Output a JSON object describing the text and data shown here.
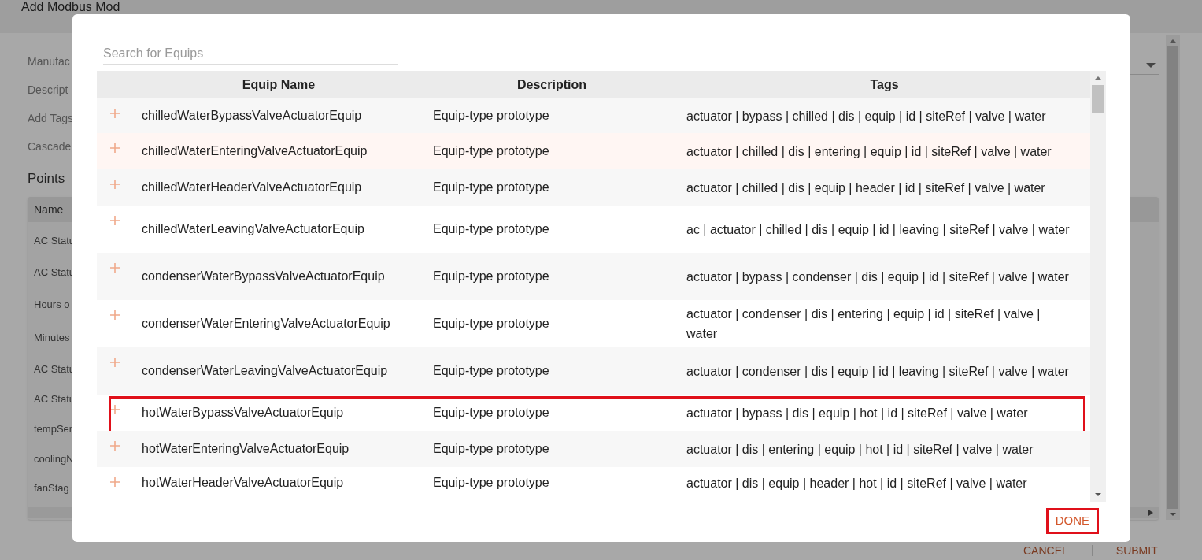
{
  "page": {
    "title": "Add Modbus Mod",
    "fields": [
      "Manufac",
      "Descript",
      "Add Tags",
      "Cascade"
    ],
    "section_title": "Points",
    "points_table": {
      "column": "Name",
      "rows": [
        "AC Statu",
        "AC Statu",
        "Hours o",
        "Minutes",
        "AC Statu",
        "AC Statu",
        "tempSer",
        "coolingN",
        "fanStag"
      ]
    },
    "buttons": [
      "CANCEL",
      "SUBMIT"
    ]
  },
  "dialog": {
    "search": {
      "placeholder": "Search for Equips"
    },
    "columns": [
      "Equip Name",
      "Description",
      "Tags"
    ],
    "rows": [
      {
        "name": "chilledWaterBypassValveActuatorEquip",
        "description": "Equip-type prototype",
        "tags": "actuator | bypass | chilled | dis | equip | id | siteRef | valve | water",
        "hovered": false,
        "highlighted": false
      },
      {
        "name": "chilledWaterEnteringValveActuatorEquip",
        "description": "Equip-type prototype",
        "tags": "actuator | chilled | dis | entering | equip | id | siteRef | valve | water",
        "hovered": true,
        "highlighted": false
      },
      {
        "name": "chilledWaterHeaderValveActuatorEquip",
        "description": "Equip-type prototype",
        "tags": "actuator | chilled | dis | equip | header | id | siteRef | valve | water",
        "hovered": false,
        "highlighted": false
      },
      {
        "name": "chilledWaterLeavingValveActuatorEquip",
        "description": "Equip-type prototype",
        "tags": "ac | actuator | chilled | dis | equip | id | leaving | siteRef | valve | water",
        "hovered": false,
        "highlighted": false
      },
      {
        "name": "condenserWaterBypassValveActuatorEquip",
        "description": "Equip-type prototype",
        "tags": "actuator | bypass | condenser | dis | equip | id | siteRef | valve | water",
        "hovered": false,
        "highlighted": false
      },
      {
        "name": "condenserWaterEnteringValveActuatorEquip",
        "description": "Equip-type prototype",
        "tags": "actuator | condenser | dis | entering | equip | id | siteRef | valve | water",
        "hovered": false,
        "highlighted": false
      },
      {
        "name": "condenserWaterLeavingValveActuatorEquip",
        "description": "Equip-type prototype",
        "tags": "actuator | condenser | dis | equip | id | leaving | siteRef | valve | water",
        "hovered": false,
        "highlighted": false
      },
      {
        "name": "hotWaterBypassValveActuatorEquip",
        "description": "Equip-type prototype",
        "tags": "actuator | bypass | dis | equip | hot | id | siteRef | valve | water",
        "hovered": false,
        "highlighted": true
      },
      {
        "name": "hotWaterEnteringValveActuatorEquip",
        "description": "Equip-type prototype",
        "tags": "actuator | dis | entering | equip | hot | id | siteRef | valve | water",
        "hovered": false,
        "highlighted": false
      },
      {
        "name": "hotWaterHeaderValveActuatorEquip",
        "description": "Equip-type prototype",
        "tags": "actuator | dis | equip | header | hot | id | siteRef | valve | water",
        "hovered": false,
        "highlighted": false
      }
    ],
    "done_button": {
      "label": "DONE",
      "highlighted": true
    }
  }
}
